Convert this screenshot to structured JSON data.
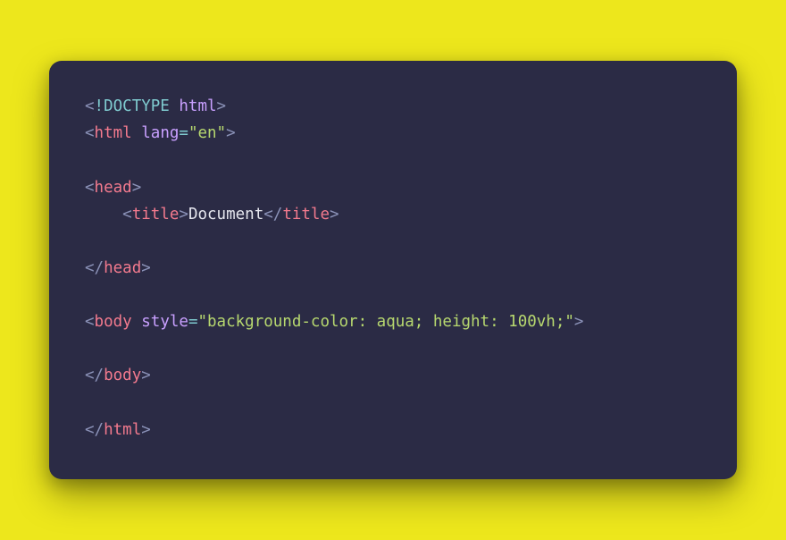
{
  "code": {
    "doctype_kw": "!DOCTYPE",
    "doctype_val": "html",
    "html_tag": "html",
    "lang_attr": "lang",
    "lang_val": "\"en\"",
    "head_tag": "head",
    "title_tag": "title",
    "title_text": "Document",
    "body_tag": "body",
    "style_attr": "style",
    "style_val": "\"background-color: aqua; height: 100vh;\"",
    "lt": "<",
    "gt": ">",
    "slash": "/",
    "eq": "=",
    "indent": "    "
  }
}
